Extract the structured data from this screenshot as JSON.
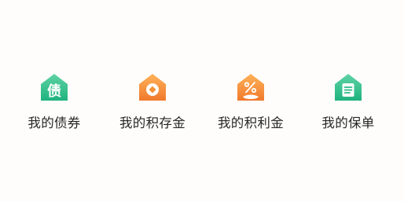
{
  "items": [
    {
      "label": "我的债券",
      "icon": "bond-house-icon",
      "glyph": "债",
      "color_top": "#5fd3a4",
      "color_bottom": "#1fb37f"
    },
    {
      "label": "我的积存金",
      "icon": "gold-savings-house-icon",
      "color_top": "#ffb25a",
      "color_bottom": "#f07a2c"
    },
    {
      "label": "我的积利金",
      "icon": "gold-interest-house-icon",
      "color_top": "#ffb25a",
      "color_bottom": "#f07a2c"
    },
    {
      "label": "我的保单",
      "icon": "policy-house-icon",
      "color_top": "#5fd3a4",
      "color_bottom": "#1fb37f"
    }
  ]
}
